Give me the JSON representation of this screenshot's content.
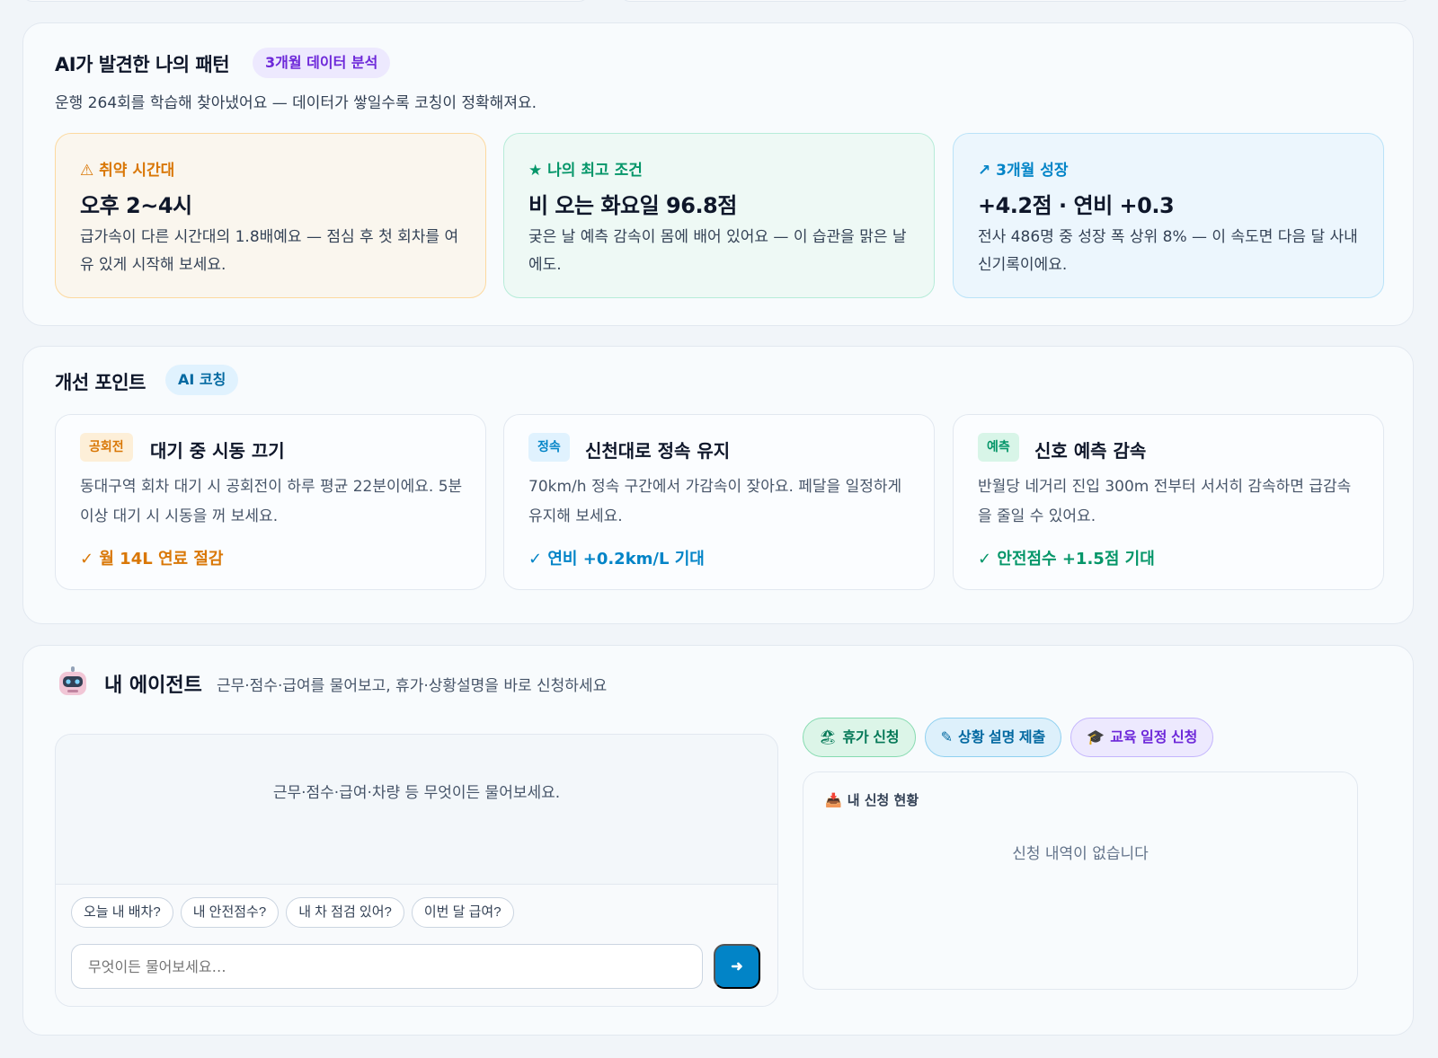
{
  "patterns": {
    "title": "AI가 발견한 나의 패턴",
    "badge": "3개월 데이터 분석",
    "subtitle": "운행 264회를 학습해 찾아냈어요 — 데이터가 쌓일수록 코칭이 정확해져요.",
    "cards": [
      {
        "icon": "warning-icon",
        "icon_glyph": "⚠",
        "kicker": "취약 시간대",
        "headline": "오후 2~4시",
        "body": "급가속이 다른 시간대의 1.8배예요 — 점심 후 첫 회차를 여유 있게 시작해 보세요."
      },
      {
        "icon": "star-icon",
        "icon_glyph": "★",
        "kicker": "나의 최고 조건",
        "headline": "비 오는 화요일 96.8점",
        "body": "궂은 날 예측 감속이 몸에 배어 있어요 — 이 습관을 맑은 날에도."
      },
      {
        "icon": "trend-up-icon",
        "icon_glyph": "↗",
        "kicker": "3개월 성장",
        "headline": "+4.2점 · 연비 +0.3",
        "body": "전사 486명 중 성장 폭 상위 8% — 이 속도면 다음 달 사내 신기록이에요."
      }
    ]
  },
  "improvements": {
    "title": "개선 포인트",
    "badge": "AI 코칭",
    "cards": [
      {
        "tag": "공회전",
        "title": "대기 중 시동 끄기",
        "body": "동대구역 회차 대기 시 공회전이 하루 평균 22분이에요. 5분 이상 대기 시 시동을 꺼 보세요.",
        "effect": "✓ 월 14L 연료 절감"
      },
      {
        "tag": "정속",
        "title": "신천대로 정속 유지",
        "body": "70km/h 정속 구간에서 가감속이 잦아요. 페달을 일정하게 유지해 보세요.",
        "effect": "✓ 연비 +0.2km/L 기대"
      },
      {
        "tag": "예측",
        "title": "신호 예측 감속",
        "body": "반월당 네거리 진입 300m 전부터 서서히 감속하면 급감속을 줄일 수 있어요.",
        "effect": "✓ 안전점수 +1.5점 기대"
      }
    ]
  },
  "agent": {
    "title": "내 에이전트",
    "subtitle": "근무·점수·급여를 물어보고, 휴가·상황설명을 바로 신청하세요",
    "chat": {
      "empty_text": "근무·점수·급여·차량 등 무엇이든 물어보세요.",
      "suggestions": [
        "오늘 내 배차?",
        "내 안전점수?",
        "내 차 점검 있어?",
        "이번 달 급여?"
      ],
      "input_placeholder": "무엇이든 물어보세요…",
      "send_glyph": "➜"
    },
    "actions": [
      {
        "icon": "vacation-icon",
        "glyph": "🏖",
        "label": "휴가 신청"
      },
      {
        "icon": "pen-icon",
        "glyph": "✎",
        "label": "상황 설명 제출"
      },
      {
        "icon": "graduation-cap-icon",
        "glyph": "🎓",
        "label": "교육 일정 신청"
      }
    ],
    "status": {
      "icon": "inbox-icon",
      "glyph": "📥",
      "title": "내 신청 현황",
      "empty_text": "신청 내역이 없습니다"
    }
  },
  "colors": {
    "accent_blue": "#0284c7",
    "warn_orange": "#d97706",
    "success_green": "#059669",
    "purple": "#6d28d9"
  }
}
